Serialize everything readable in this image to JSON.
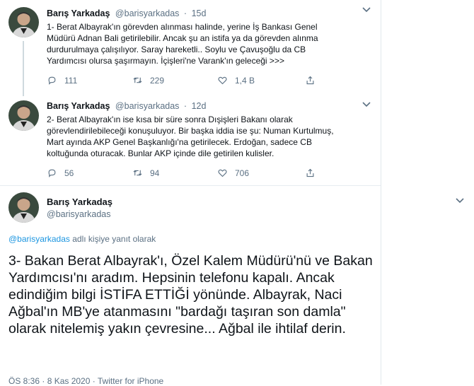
{
  "tweets": [
    {
      "name": "Barış Yarkadaş",
      "handle": "@barisyarkadas",
      "dot": "·",
      "time": "15d",
      "text": "1- Berat Albayrak'ın görevden alınması halinde, yerine İş Bankası Genel Müdürü Adnan Bali getirilebilir. Ancak şu an istifa ya da görevden alınma durdurulmaya çalışılıyor. Saray hareketli.. Soylu ve Çavuşoğlu da CB Yardımcısı olursa şaşırmayın. İçişleri'ne Varank'ın geleceği >>>",
      "replies": "111",
      "retweets": "229",
      "likes": "1,4 B"
    },
    {
      "name": "Barış Yarkadaş",
      "handle": "@barisyarkadas",
      "dot": "·",
      "time": "12d",
      "text": "2- Berat Albayrak'ın ise kısa bir süre sonra Dışişleri Bakanı olarak görevlendirilebileceği konuşuluyor. Bir başka iddia ise şu: Numan Kurtulmuş, Mart ayında AKP Genel Başkanlığı'na getirilecek. Erdoğan, sadece CB koltuğunda oturacak. Bunlar AKP içinde dile getirilen kulisler.",
      "replies": "56",
      "retweets": "94",
      "likes": "706"
    }
  ],
  "main": {
    "name": "Barış Yarkadaş",
    "handle": "@barisyarkadas",
    "reply_mention": "@barisyarkadas",
    "reply_suffix": " adlı kişiye yanıt olarak",
    "text": "3- Bakan Berat Albayrak'ı, Özel Kalem Müdürü'nü ve Bakan Yardımcısı'nı aradım. Hepsinin telefonu kapalı. Ancak edindiğim bilgi İSTİFA ETTİĞİ yönünde. Albayrak, Naci Ağbal'ın MB'ye atanmasını \"bardağı taşıran son damla\" olarak nitelemiş yakın çevresine... Ağbal ile ihtilaf derin.",
    "footer": "ÖS 8:36 · 8 Kas 2020 · Twitter for iPhone"
  },
  "icons": {
    "more": "chevron-down-icon",
    "reply": "reply-icon",
    "retweet": "retweet-icon",
    "like": "heart-icon"
  },
  "colors": {
    "text": "#0f1419",
    "secondary": "#5b7083",
    "link": "#1b95e0",
    "thread_line": "#cfd9de"
  }
}
